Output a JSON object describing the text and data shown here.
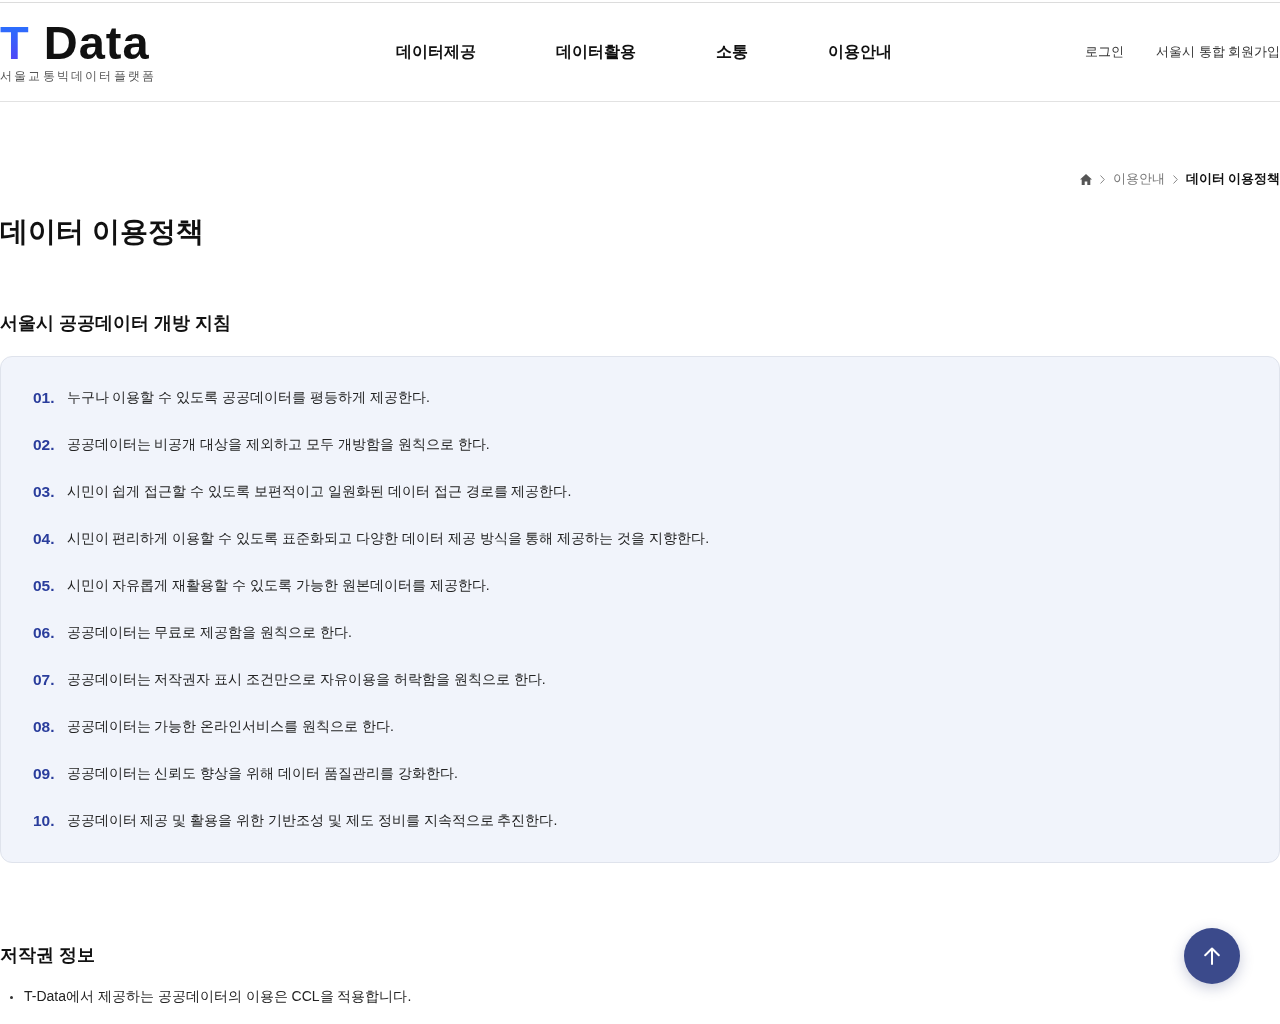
{
  "header": {
    "logo": {
      "mark": "T",
      "name": "Data",
      "tagline": "서울교통빅데이터플랫폼"
    },
    "nav": [
      "데이터제공",
      "데이터활용",
      "소통",
      "이용안내"
    ],
    "user_links": [
      "로그인",
      "서울시 통합 회원가입"
    ]
  },
  "breadcrumb": [
    {
      "label": "이용안내",
      "current": false
    },
    {
      "label": "데이터 이용정책",
      "current": true
    }
  ],
  "page_title": "데이터 이용정책",
  "guidelines": {
    "title": "서울시 공공데이터 개방 지침",
    "items": [
      {
        "number": "01.",
        "text": "누구나 이용할 수 있도록 공공데이터를 평등하게 제공한다."
      },
      {
        "number": "02.",
        "text": "공공데이터는 비공개 대상을 제외하고 모두 개방함을 원칙으로 한다."
      },
      {
        "number": "03.",
        "text": "시민이 쉽게 접근할 수 있도록 보편적이고 일원화된 데이터 접근 경로를 제공한다."
      },
      {
        "number": "04.",
        "text": "시민이 편리하게 이용할 수 있도록 표준화되고 다양한 데이터 제공 방식을 통해 제공하는 것을 지향한다."
      },
      {
        "number": "05.",
        "text": "시민이 자유롭게 재활용할 수 있도록 가능한 원본데이터를 제공한다."
      },
      {
        "number": "06.",
        "text": "공공데이터는 무료로 제공함을 원칙으로 한다."
      },
      {
        "number": "07.",
        "text": "공공데이터는 저작권자 표시 조건만으로 자유이용을 허락함을 원칙으로 한다."
      },
      {
        "number": "08.",
        "text": "공공데이터는 가능한 온라인서비스를 원칙으로 한다."
      },
      {
        "number": "09.",
        "text": "공공데이터는 신뢰도 향상을 위해 데이터 품질관리를 강화한다."
      },
      {
        "number": "10.",
        "text": "공공데이터 제공 및 활용을 위한 기반조성 및 제도 정비를 지속적으로 추진한다."
      }
    ]
  },
  "copyright": {
    "title": "저작권 정보",
    "items": [
      "T-Data에서 제공하는 공공데이터의 이용은 CCL을 적용합니다."
    ]
  }
}
